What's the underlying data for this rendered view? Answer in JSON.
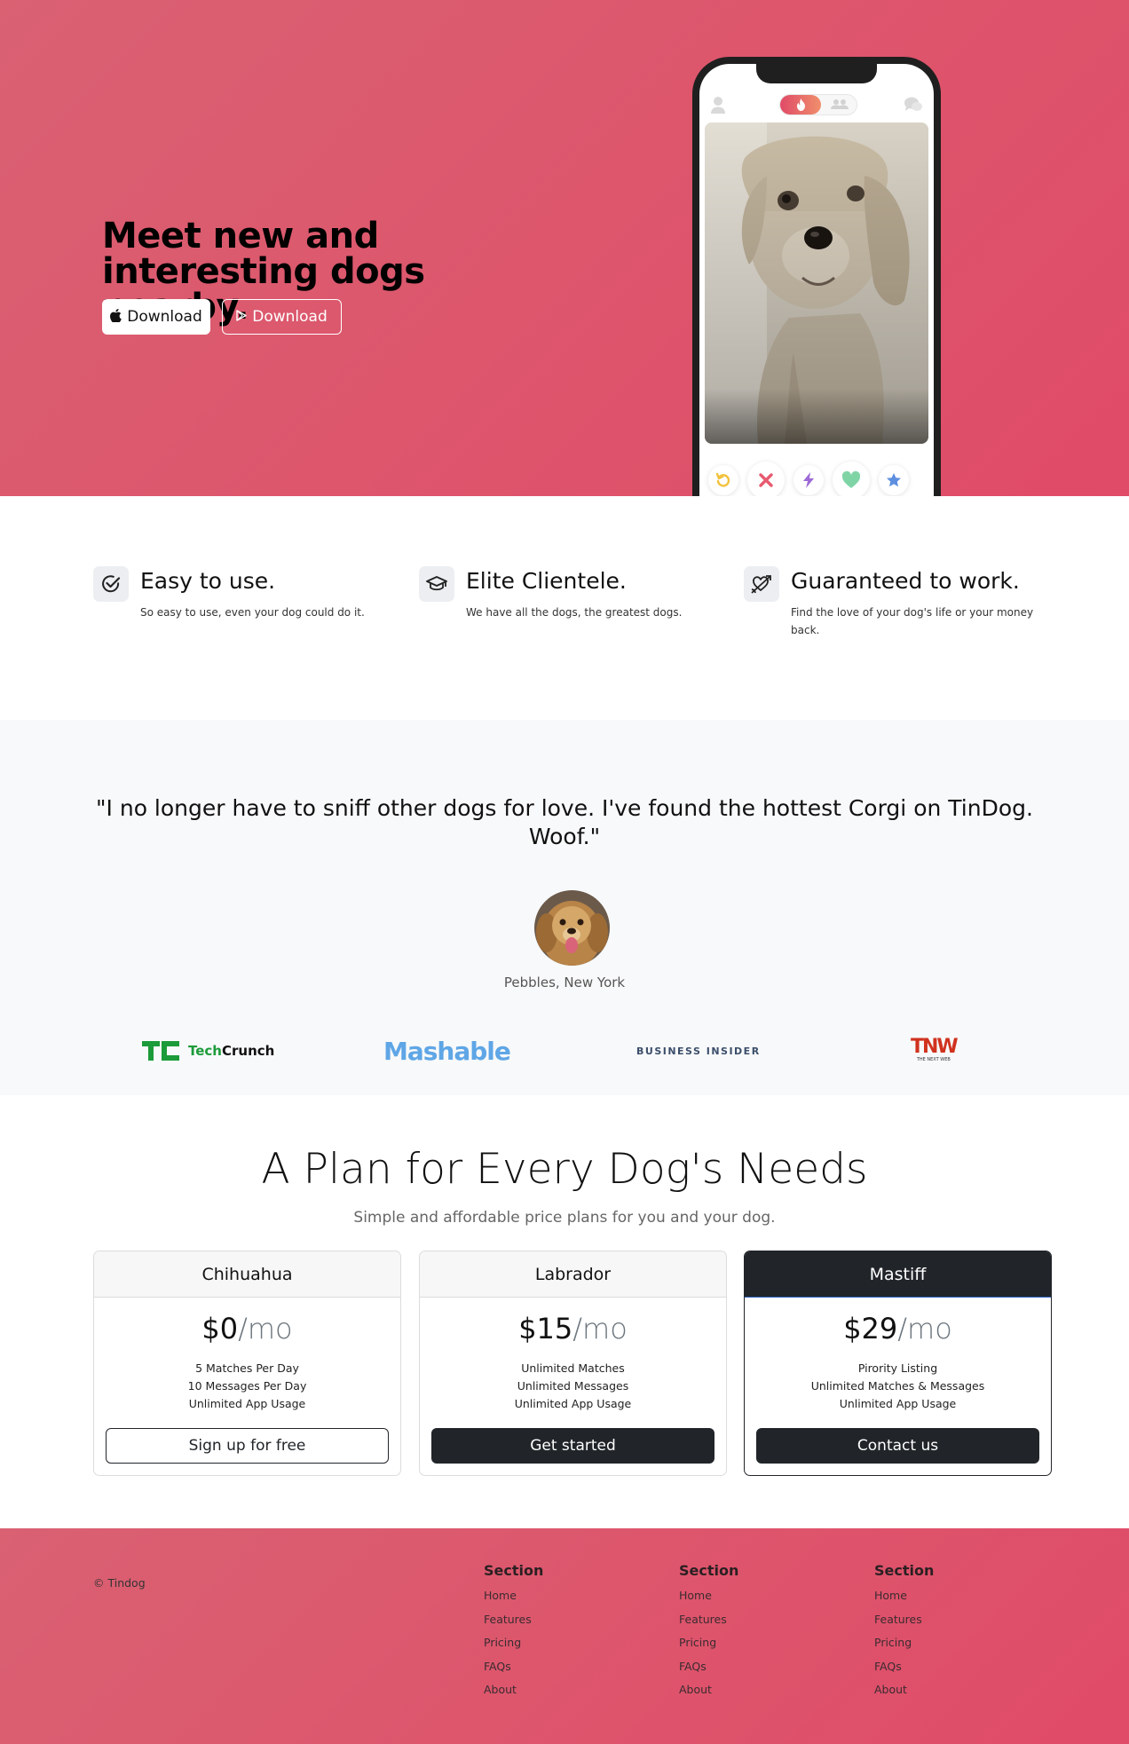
{
  "hero": {
    "title": "Meet new and interesting dogs nearby.",
    "apple_button": "Download",
    "play_button": "Download"
  },
  "features": [
    {
      "title": "Easy to use.",
      "desc": "So easy to use, even your dog could do it.",
      "icon": "check-circle-icon"
    },
    {
      "title": "Elite Clientele.",
      "desc": "We have all the dogs, the greatest dogs.",
      "icon": "graduation-cap-icon"
    },
    {
      "title": "Guaranteed to work.",
      "desc": "Find the love of your dog's life or your money back.",
      "icon": "heart-arrow-icon"
    }
  ],
  "testimonial": {
    "quote": "\"I no longer have to sniff other dogs for love. I've found the hottest Corgi on TinDog. Woof.\"",
    "author": "Pebbles, New York"
  },
  "press": {
    "techcrunch_main": "Tech",
    "techcrunch_bold": "Crunch",
    "mashable": "Mashable",
    "business_insider": "BUSINESS INSIDER",
    "tnw": "TNW",
    "tnw_sub": "THE NEXT WEB"
  },
  "pricing": {
    "title": "A Plan for Every Dog's Needs",
    "subtitle": "Simple and affordable price plans for you and your dog.",
    "plans": [
      {
        "name": "Chihuahua",
        "price": "$0",
        "per": "/mo",
        "features": [
          "5 Matches Per Day",
          "10 Messages Per Day",
          "Unlimited App Usage"
        ],
        "button": "Sign up for free"
      },
      {
        "name": "Labrador",
        "price": "$15",
        "per": "/mo",
        "features": [
          "Unlimited Matches",
          "Unlimited Messages",
          "Unlimited App Usage"
        ],
        "button": "Get started"
      },
      {
        "name": "Mastiff",
        "price": "$29",
        "per": "/mo",
        "features": [
          "Pirority Listing",
          "Unlimited Matches & Messages",
          "Unlimited App Usage"
        ],
        "button": "Contact us"
      }
    ]
  },
  "footer": {
    "copyright": "© Tindog",
    "columns": [
      {
        "heading": "Section",
        "links": [
          "Home",
          "Features",
          "Pricing",
          "FAQs",
          "About"
        ]
      },
      {
        "heading": "Section",
        "links": [
          "Home",
          "Features",
          "Pricing",
          "FAQs",
          "About"
        ]
      },
      {
        "heading": "Section",
        "links": [
          "Home",
          "Features",
          "Pricing",
          "FAQs",
          "About"
        ]
      }
    ]
  },
  "colors": {
    "brand": "#dd566c",
    "dark": "#212529",
    "light_bg": "#f8f9fa"
  }
}
